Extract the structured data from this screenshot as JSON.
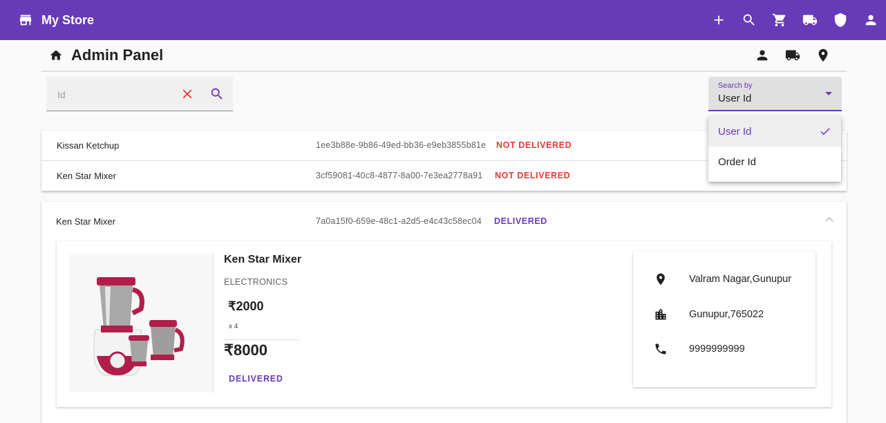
{
  "app": {
    "brand_name": "My Store",
    "brand_icon": "store-icon",
    "accent": "#673ab7",
    "actions": [
      "add-icon",
      "search-icon",
      "cart-icon",
      "truck-icon",
      "shield-icon",
      "account-icon"
    ]
  },
  "panel": {
    "title": "Admin Panel",
    "icons": [
      "person-icon",
      "truck-icon",
      "location-pin-icon"
    ]
  },
  "search": {
    "placeholder": "Id",
    "value": ""
  },
  "search_by": {
    "label": "Search by",
    "selected": "User Id",
    "options": [
      "User Id",
      "Order Id"
    ]
  },
  "orders": [
    {
      "product": "Kissan Ketchup",
      "order_id": "1ee3b88e-9b86-49ed-bb36-e9eb3855b81e",
      "status": "NOT DELIVERED"
    },
    {
      "product": "Ken Star Mixer",
      "order_id": "3cf59081-40c8-4877-8a00-7e3ea2778a91",
      "status": "NOT DELIVERED"
    }
  ],
  "expanded_order": {
    "product": "Ken Star Mixer",
    "order_id": "7a0a15f0-659e-48c1-a2d5-e4c43c58ec04",
    "status": "DELIVERED",
    "detail": {
      "title": "Ken Star Mixer",
      "category": "ELECTRONICS",
      "price": "₹2000",
      "quantity": "x 4",
      "total": "₹8000",
      "status": "DELIVERED",
      "image_icon": "mixer-grinder-image"
    },
    "address": {
      "street": "Valram Nagar,Gunupur",
      "city": "Gunupur,765022",
      "phone": "9999999999"
    }
  },
  "colors": {
    "not_delivered": "#e53935",
    "delivered": "#673ab7",
    "appbar": "#673ab7"
  }
}
